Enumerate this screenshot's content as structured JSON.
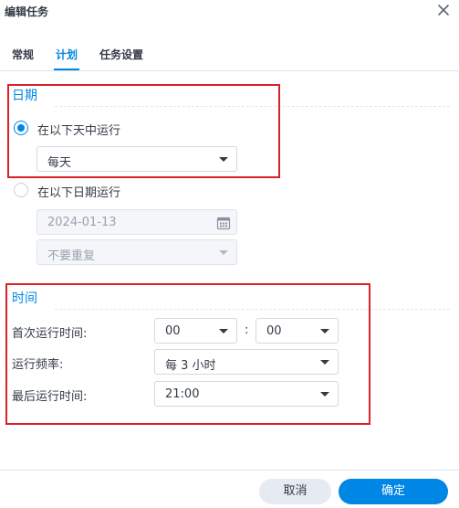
{
  "window": {
    "title": "编辑任务"
  },
  "tabs": [
    {
      "label": "常规",
      "active": false
    },
    {
      "label": "计划",
      "active": true
    },
    {
      "label": "任务设置",
      "active": false
    }
  ],
  "date_section": {
    "title": "日期",
    "option_daily": {
      "label": "在以下天中运行",
      "checked": true
    },
    "day_select": {
      "value": "每天"
    },
    "option_date": {
      "label": "在以下日期运行",
      "checked": false
    },
    "date_input": {
      "value": "2024-01-13"
    },
    "repeat_select": {
      "value": "不要重复"
    }
  },
  "time_section": {
    "title": "时间",
    "first_run": {
      "label": "首次运行时间:",
      "hour": "00",
      "minute": "00",
      "separator": ":"
    },
    "frequency": {
      "label": "运行频率:",
      "value": "每 3 小时"
    },
    "last_run": {
      "label": "最后运行时间:",
      "value": "21:00"
    }
  },
  "footer": {
    "cancel_label": "取消",
    "ok_label": "确定"
  },
  "colors": {
    "accent": "#0086e5",
    "annotation_box": "#d8232a",
    "text": "#333a47"
  },
  "icons": {
    "close": "close-icon",
    "calendar": "calendar-icon",
    "dropdown": "chevron-down-icon"
  }
}
